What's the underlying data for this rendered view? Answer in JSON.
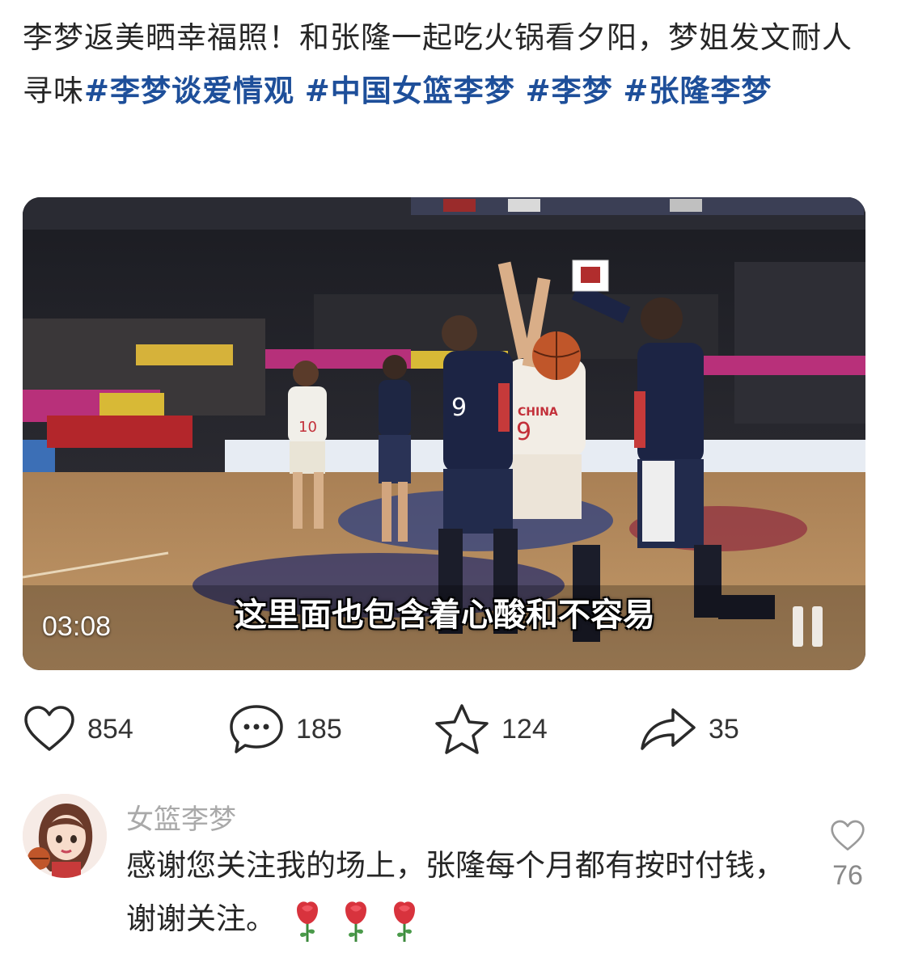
{
  "post": {
    "text": "李梦返美晒幸福照！和张隆一起吃火锅看夕阳，梦姐发文耐人寻味",
    "tags": [
      "#李梦谈爱情观",
      "#中国女篮李梦",
      "#李梦",
      "#张隆李梦"
    ]
  },
  "video": {
    "duration": "03:08",
    "subtitle": "这里面也包含着心酸和不容易",
    "jersey_numbers": [
      "10",
      "9",
      "9"
    ],
    "jersey_text": "CHINA"
  },
  "actions": {
    "likes": "854",
    "comments": "185",
    "favorites": "124",
    "shares": "35"
  },
  "comment": {
    "username": "女篮李梦",
    "text": "感谢您关注我的场上，张隆每个月都有按时付钱，谢谢关注。",
    "likes": "76",
    "emoji_count": 3
  }
}
